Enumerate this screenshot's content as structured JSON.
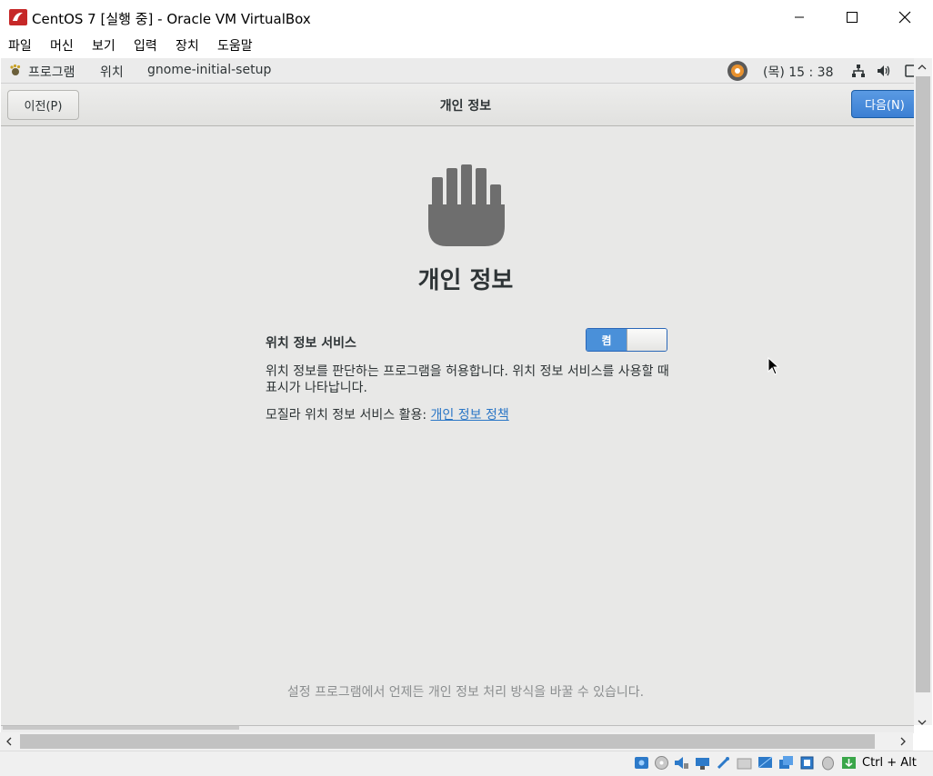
{
  "window": {
    "title": "CentOS 7 [실행 중] - Oracle VM VirtualBox"
  },
  "menu": {
    "items": [
      "파일",
      "머신",
      "보기",
      "입력",
      "장치",
      "도움말"
    ]
  },
  "gnome_panel": {
    "applications": "프로그램",
    "places": "위치",
    "app_name": "gnome-initial-setup",
    "clock": "(목) 15 : 38"
  },
  "header": {
    "prev_label": "이전(P)",
    "title": "개인 정보",
    "next_label": "다음(N)"
  },
  "privacy": {
    "heading": "개인 정보",
    "location_label": "위치 정보 서비스",
    "toggle_state": "켬",
    "location_desc": "위치 정보를 판단하는 프로그램을 허용합니다. 위치 정보 서비스를 사용할 때 표시가 나타납니다.",
    "mozilla_prefix": "모질라 위치 정보 서비스 활용: ",
    "privacy_link": "개인 정보 정책",
    "footer_note": "설정 프로그램에서 언제든 개인 정보 처리 방식을 바꿀 수 있습니다."
  },
  "statusbar": {
    "host_key": "Ctrl + Alt"
  },
  "colors": {
    "accent": "#4a90d9",
    "link": "#2a76c6"
  }
}
